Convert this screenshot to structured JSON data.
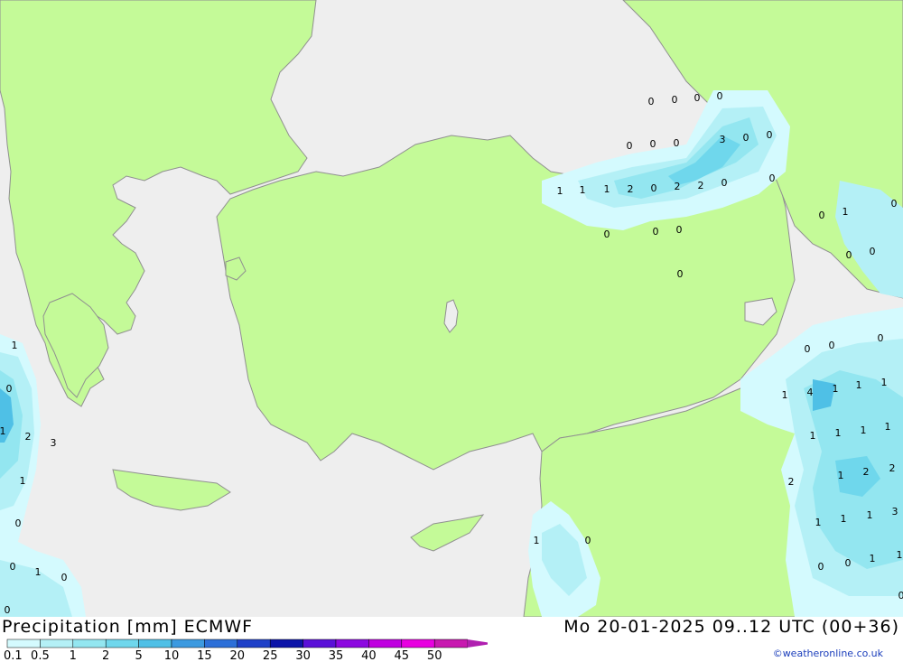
{
  "title": {
    "left": "Precipitation [mm] ECMWF",
    "right": "Mo 20-01-2025 09..12 UTC (00+36)",
    "credit": "©weatheronline.co.uk"
  },
  "legend": {
    "labels": [
      "0.1",
      "0.5",
      "1",
      "2",
      "5",
      "10",
      "15",
      "20",
      "25",
      "30",
      "35",
      "40",
      "45",
      "50"
    ],
    "colors": [
      "#d4fafe",
      "#b4f0f6",
      "#93e6f0",
      "#6fd7ec",
      "#4fc0e6",
      "#3c9ae0",
      "#2c6fd8",
      "#1e40c8",
      "#0c14a8",
      "#5a10d8",
      "#8c08e0",
      "#c000e0",
      "#e800e0",
      "#c818b0"
    ]
  },
  "colors": {
    "sea": "#eeeeee",
    "land": "#c4fa98",
    "border": "#909090"
  },
  "map_values": [
    "0",
    "0",
    "0",
    "0",
    "0",
    "0",
    "0",
    "3",
    "0",
    "0",
    "1",
    "1",
    "1",
    "2",
    "0",
    "2",
    "2",
    "0",
    "0",
    "0",
    "0",
    "0",
    "0",
    "0",
    "0",
    "1",
    "0",
    "0",
    "0",
    "0",
    "0",
    "1",
    "4",
    "1",
    "1",
    "1",
    "1",
    "1",
    "1",
    "1",
    "1",
    "2",
    "2",
    "2",
    "1",
    "1",
    "1",
    "3",
    "0",
    "0",
    "1",
    "1",
    "0",
    "1",
    "0",
    "1",
    "2",
    "3",
    "1",
    "0",
    "0",
    "1",
    "0",
    "0",
    "1",
    "0"
  ]
}
